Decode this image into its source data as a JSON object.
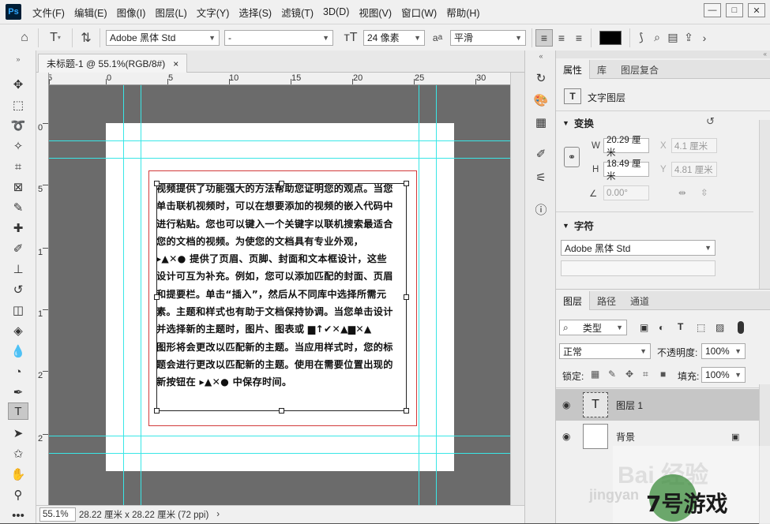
{
  "app": {
    "logo": "Ps"
  },
  "menu": [
    "文件(F)",
    "编辑(E)",
    "图像(I)",
    "图层(L)",
    "文字(Y)",
    "选择(S)",
    "滤镜(T)",
    "3D(D)",
    "视图(V)",
    "窗口(W)",
    "帮助(H)"
  ],
  "window_controls": [
    "—",
    "□",
    "✕"
  ],
  "options": {
    "font_family": "Adobe 黑体 Std",
    "font_style": "-",
    "font_size": "24 像素",
    "aa_label": "a",
    "antialias": "平滑",
    "text_color": "#000000"
  },
  "document": {
    "tab_title": "未标题-1 @ 55.1%(RGB/8#)",
    "tab_close": "×",
    "ruler_top_labels": [
      "5",
      "0",
      "5",
      "10",
      "15",
      "20",
      "25",
      "30"
    ],
    "ruler_left_labels": [
      "0",
      "5",
      "1",
      "1",
      "2",
      "2"
    ],
    "text_lines": [
      "视频提供了功能强大的方法帮助您证明您的观点。当您",
      "单击联机视频时，可以在想要添加的视频的嵌入代码中",
      "进行粘贴。您也可以键入一个关键字以联机搜索最适合",
      "您的文档的视频。为使您的文档具有专业外观，",
      "▸▲✕● 提供了页眉、页脚、封面和文本框设计，这些",
      "设计可互为补充。例如，您可以添加匹配的封面、页眉",
      "和提要栏。单击“插入”，然后从不同库中选择所需元",
      "素。主题和样式也有助于文档保持协调。当您单击设计",
      "并选择新的主题时，图片、图表或 ▆↑✔✕▲▆✕▲",
      "图形将会更改以匹配新的主题。当应用样式时，您的标",
      "题会进行更改以匹配新的主题。使用在需要位置出现的",
      "新按钮在 ▸▲✕● 中保存时间。"
    ]
  },
  "status": {
    "zoom": "55.1%",
    "info": "28.22 厘米 x 28.22 厘米 (72 ppi)",
    "arrow": "›"
  },
  "properties": {
    "tabs": [
      "属性",
      "库",
      "图层复合"
    ],
    "layer_type": "文字图层",
    "transform_title": "变换",
    "w_label": "W",
    "w_value": "20.29 厘米",
    "h_label": "H",
    "h_value": "18.49 厘米",
    "x_label": "X",
    "x_value": "4.1 厘米",
    "y_label": "Y",
    "y_value": "4.81 厘米",
    "angle_value": "0.00°",
    "char_title": "字符",
    "char_font": "Adobe 黑体 Std"
  },
  "layers": {
    "tabs": [
      "图层",
      "路径",
      "通道"
    ],
    "filter_kind": "类型",
    "blend_mode": "正常",
    "opacity_label": "不透明度:",
    "opacity_value": "100%",
    "lock_label": "锁定:",
    "fill_label": "填充:",
    "fill_value": "100%",
    "items": [
      {
        "name": "图层 1",
        "thumb": "T",
        "selected": true
      },
      {
        "name": "背景",
        "thumb": "",
        "selected": false
      }
    ],
    "lock_glyph": "🔒",
    "eye_glyph": "●"
  },
  "watermark": {
    "baidu": "Bai 经验",
    "jingyan": "jingyan",
    "site": "7号游戏"
  }
}
